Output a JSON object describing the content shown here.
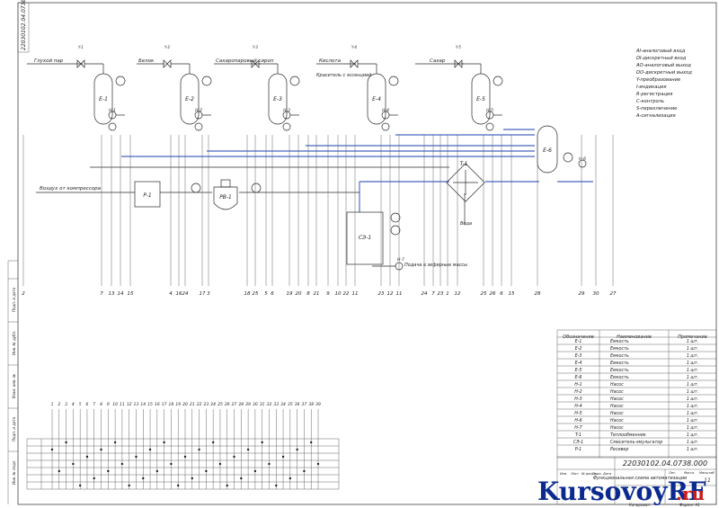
{
  "sheet": {
    "drawing_code": "22030102.04.0738.000",
    "sheet_title": "Функциональная схема автоматизации",
    "sheet_number": "11",
    "watermark_brand": "KursovoyRF",
    "watermark_domain": ".ru",
    "footer_left": "Копировал",
    "footer_right": "Формат A1"
  },
  "legend": [
    "AI-аналоговый вход",
    "DI-дискретный вход",
    "AO-аналоговый выход",
    "DO-дискретный выход",
    "Y-преобразование",
    "I-индикация",
    "R-регистрация",
    "C-контроль",
    "S-переключение",
    "A-сигнализация"
  ],
  "tanks": [
    {
      "id": "E-1",
      "pump": "H-1",
      "valve": "Y-1"
    },
    {
      "id": "E-2",
      "pump": "H-2",
      "valve": "Y-2"
    },
    {
      "id": "E-3",
      "pump": "H-3",
      "valve": "Y-3"
    },
    {
      "id": "E-4",
      "pump": "H-4",
      "valve": "Y-4"
    },
    {
      "id": "E-5",
      "pump": "H-5",
      "valve": "Y-5"
    }
  ],
  "mixer": {
    "id": "E-6",
    "pump": "H-6"
  },
  "feed_labels": {
    "steam": "Глухой пар",
    "white": "Белок",
    "sugar_syrup": "Сахаропаровый сироп",
    "acid": "Кислота",
    "dye": "Краситель с эссенцией",
    "sugar": "Сахар",
    "air": "Воздух от компрессора",
    "water": "Вода",
    "outlet": "Подача в зефирные массы"
  },
  "equipment": {
    "receiver": "P-1",
    "regulator": "PB-1",
    "heat_exchanger": "T-1",
    "mixer_unit": "CЭ-1",
    "pump_out": "H-7"
  },
  "terminal_numbers": [
    "2",
    "7",
    "13",
    "14",
    "15",
    "4",
    "16",
    "24",
    "17",
    "3",
    "18",
    "25",
    "5",
    "6",
    "19",
    "20",
    "8",
    "21",
    "9",
    "10",
    "22",
    "11",
    "23",
    "12",
    "11",
    "24",
    "7",
    "23",
    "1",
    "12",
    "25",
    "26",
    "6",
    "15",
    "28",
    "29",
    "30",
    "27"
  ],
  "matrix": {
    "columns": [
      "1",
      "2",
      "3",
      "4",
      "5",
      "6",
      "7",
      "8",
      "9",
      "10",
      "11",
      "12",
      "13",
      "14",
      "15",
      "16",
      "17",
      "18",
      "19",
      "20",
      "21",
      "22",
      "23",
      "24",
      "25",
      "26",
      "27",
      "28",
      "29",
      "30",
      "31",
      "32",
      "33",
      "34",
      "35",
      "36",
      "37",
      "38",
      "39"
    ],
    "rows": 7
  },
  "spec_table": {
    "headers": [
      "Обозначение",
      "Наименование",
      "Примечание"
    ],
    "rows": [
      [
        "E-1",
        "Емкость",
        "1 шт."
      ],
      [
        "E-2",
        "Емкость",
        "1 шт."
      ],
      [
        "E-3",
        "Емкость",
        "1 шт."
      ],
      [
        "E-4",
        "Емкость",
        "1 шт."
      ],
      [
        "E-5",
        "Емкость",
        "1 шт."
      ],
      [
        "E-6",
        "Емкость",
        "1 шт."
      ],
      [
        "H-1",
        "Насос",
        "1 шт."
      ],
      [
        "H-2",
        "Насос",
        "1 шт."
      ],
      [
        "H-3",
        "Насос",
        "1 шт."
      ],
      [
        "H-4",
        "Насос",
        "1 шт."
      ],
      [
        "H-5",
        "Насос",
        "1 шт."
      ],
      [
        "H-6",
        "Насос",
        "1 шт."
      ],
      [
        "H-7",
        "Насос",
        "1 шт."
      ],
      [
        "T-1",
        "Теплообменник",
        "1 шт."
      ],
      [
        "CЭ-1",
        "Смеситель-эмульгатор",
        "1 шт."
      ],
      [
        "P-1",
        "Ресивер",
        "1 шт."
      ]
    ]
  },
  "margin_labels": [
    "Подп. и дата",
    "Инв. № дубл.",
    "Взам. инв. №",
    "Подп. и дата",
    "Инв. № подл."
  ],
  "title_block_labels": [
    "Изм.",
    "Лист",
    "№ докум.",
    "Подп.",
    "Дата",
    "Лит.",
    "Масса",
    "Масштаб"
  ]
}
